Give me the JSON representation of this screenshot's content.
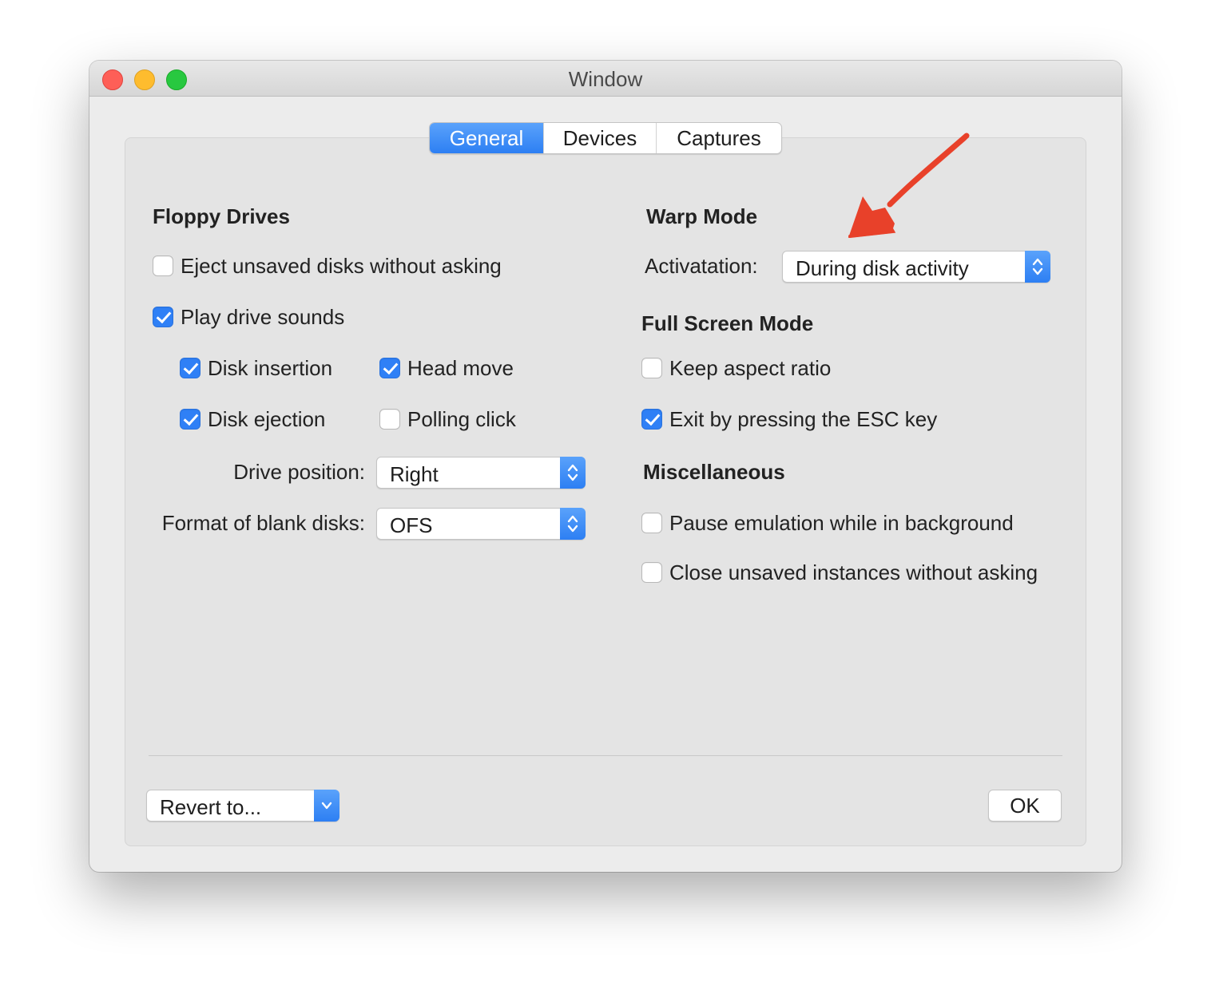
{
  "window": {
    "title": "Window"
  },
  "tabs": [
    {
      "label": "General",
      "active": true
    },
    {
      "label": "Devices",
      "active": false
    },
    {
      "label": "Captures",
      "active": false
    }
  ],
  "floppy": {
    "heading": "Floppy Drives",
    "eject_unsaved": {
      "label": "Eject unsaved disks without asking",
      "checked": false
    },
    "play_sounds": {
      "label": "Play drive sounds",
      "checked": true
    },
    "disk_insertion": {
      "label": "Disk insertion",
      "checked": true
    },
    "head_move": {
      "label": "Head move",
      "checked": true
    },
    "disk_ejection": {
      "label": "Disk ejection",
      "checked": true
    },
    "polling_click": {
      "label": "Polling click",
      "checked": false
    },
    "drive_position": {
      "label": "Drive position:",
      "value": "Right"
    },
    "blank_format": {
      "label": "Format of blank disks:",
      "value": "OFS"
    }
  },
  "warp": {
    "heading": "Warp Mode",
    "activation": {
      "label": "Activatation:",
      "value": "During disk activity"
    }
  },
  "fullscreen": {
    "heading": "Full Screen Mode",
    "keep_aspect": {
      "label": "Keep aspect ratio",
      "checked": false
    },
    "exit_esc": {
      "label": "Exit by pressing the ESC key",
      "checked": true
    }
  },
  "misc": {
    "heading": "Miscellaneous",
    "pause_bg": {
      "label": "Pause emulation while in background",
      "checked": false
    },
    "close_unsaved": {
      "label": "Close unsaved instances without asking",
      "checked": false
    }
  },
  "footer": {
    "revert_label": "Revert to...",
    "ok_label": "OK"
  },
  "colors": {
    "accent": "#2f80f6",
    "annotation_arrow": "#e8412a"
  }
}
